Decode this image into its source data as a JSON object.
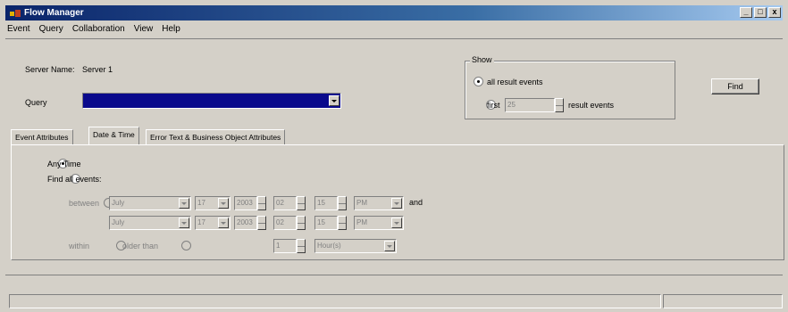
{
  "window": {
    "title": "Flow Manager",
    "buttons": [
      "_",
      "□",
      "x"
    ]
  },
  "menu": [
    "Event",
    "Query",
    "Collaboration",
    "View",
    "Help"
  ],
  "server": {
    "label": "Server Name:",
    "value": "Server 1"
  },
  "query": {
    "label": "Query",
    "value": ""
  },
  "show": {
    "title": "Show",
    "option_all": "all result events",
    "option_first": "first",
    "first_count": "25",
    "first_suffix": "result events"
  },
  "find_label": "Find",
  "tabs": [
    "Event Attributes",
    "Date & Time",
    "Error Text & Business Object Attributes"
  ],
  "date_time": {
    "any_time": "Any Time",
    "find_all": "Find all events:",
    "between_label": "between",
    "and_label": "and",
    "within_label": "within",
    "older_label": "older than",
    "row1": {
      "month": "July",
      "day": "17",
      "year": "2003",
      "hour": "02",
      "minute": "15",
      "ampm": "PM"
    },
    "row2": {
      "month": "July",
      "day": "17",
      "year": "2003",
      "hour": "02",
      "minute": "15",
      "ampm": "PM"
    },
    "within_count": "1",
    "within_unit": "Hour(s)"
  },
  "colors": {
    "title_start": "#0a246a",
    "title_end": "#a6caf0",
    "query_fill": "#0a0a8c"
  }
}
